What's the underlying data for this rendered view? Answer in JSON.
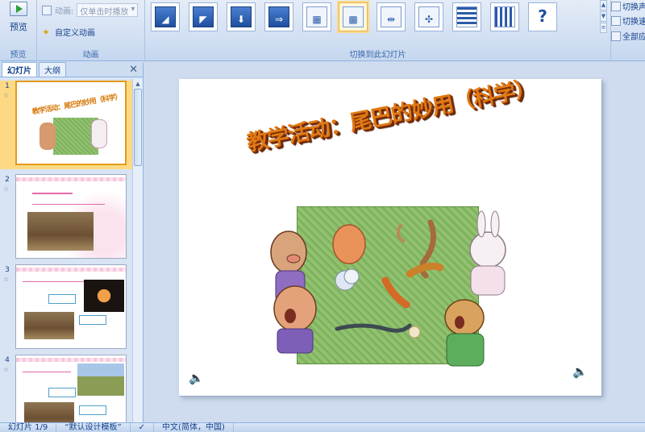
{
  "ribbon": {
    "preview_label": "预览",
    "preview_group_label": "预览",
    "animation_row_label": "动画:",
    "animation_select_value": "仅单击时播放",
    "custom_animation_label": "自定义动画",
    "animation_group_label": "动画",
    "transition_group_label": "切换到此幻灯片",
    "transition_sound_label": "切换声",
    "transition_speed_label": "切换速",
    "apply_all_label": "全部应"
  },
  "left_pane": {
    "tab_slides": "幻灯片",
    "tab_outline": "大纲",
    "close_glyph": "✕",
    "slides": [
      {
        "number": "1",
        "selected": true
      },
      {
        "number": "2",
        "selected": false
      },
      {
        "number": "3",
        "selected": false
      },
      {
        "number": "4",
        "selected": false
      }
    ]
  },
  "slide": {
    "title": "教学活动：尾巴的妙用（科学）"
  },
  "status": {
    "slide_indicator": "幻灯片 1/9",
    "theme": "“默认设计模板”",
    "language": "中文(简体，中国)"
  },
  "colors": {
    "ribbon_bg": "#d3e0f3",
    "selected_thumb": "#fdd983",
    "title_orange": "#e07a14"
  }
}
